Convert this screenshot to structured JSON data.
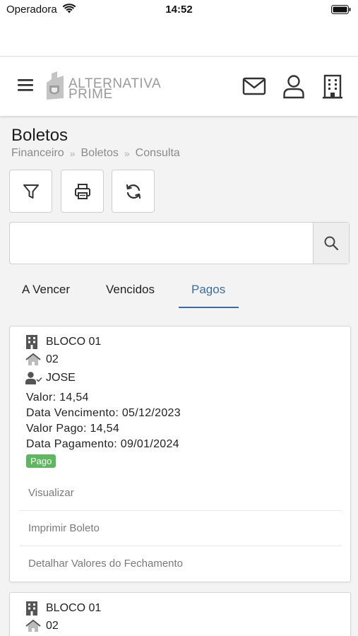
{
  "status_bar": {
    "carrier": "Operadora",
    "time": "14:52"
  },
  "header": {
    "logo_line1": "ALTERNATIVA",
    "logo_line2": "PRIME"
  },
  "page": {
    "title": "Boletos",
    "breadcrumb": [
      "Financeiro",
      "Boletos",
      "Consulta"
    ],
    "breadcrumb_sep": "»"
  },
  "search": {
    "placeholder": "",
    "value": ""
  },
  "tabs": [
    {
      "label": "A Vencer"
    },
    {
      "label": "Vencidos"
    },
    {
      "label": "Pagos",
      "active": true
    }
  ],
  "boletos": [
    {
      "bloco": "BLOCO 01",
      "unidade": "02",
      "morador": "JOSE",
      "valor_label": "Valor:",
      "valor": "14,54",
      "vencimento_label": "Data Vencimento:",
      "vencimento": "05/12/2023",
      "valor_pago_label": "Valor Pago:",
      "valor_pago": "14,54",
      "pagamento_label": "Data Pagamento:",
      "pagamento": "09/01/2024",
      "status": "Pago",
      "actions": [
        "Visualizar",
        "Imprimir Boleto",
        "Detalhar Valores do Fechamento"
      ]
    },
    {
      "bloco": "BLOCO 01",
      "unidade": "02"
    }
  ],
  "colors": {
    "accent": "#3b6ea0",
    "paid_badge": "#5cb85c",
    "background": "#f3f3f3"
  },
  "icons": [
    "wifi-icon",
    "battery-icon",
    "menu-icon",
    "mail-icon",
    "user-icon",
    "building-icon",
    "filter-icon",
    "print-icon",
    "refresh-icon",
    "search-icon",
    "home-icon",
    "user-check-icon"
  ]
}
